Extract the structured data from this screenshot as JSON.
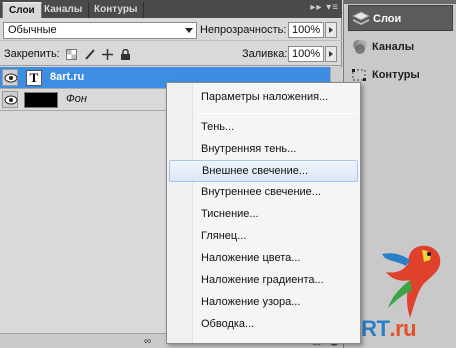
{
  "tabs": [
    {
      "label": "Слои"
    },
    {
      "label": "Каналы"
    },
    {
      "label": "Контуры"
    }
  ],
  "panel_menu_icon": "double-chevron-menu-icon",
  "blend": {
    "mode": "Обычные",
    "opacity_label": "Непрозрачность:",
    "opacity_value": "100%"
  },
  "lock": {
    "label": "Закрепить:",
    "fill_label": "Заливка:",
    "fill_value": "100%",
    "icons": [
      "lock-transparency-icon",
      "lock-brush-icon",
      "lock-move-icon",
      "lock-all-icon"
    ]
  },
  "layers": [
    {
      "name": "8art.ru",
      "type": "text",
      "selected": true
    },
    {
      "name": "Фон",
      "type": "raster",
      "selected": false
    }
  ],
  "dock": {
    "items": [
      {
        "label": "Слои"
      },
      {
        "label": "Каналы"
      },
      {
        "label": "Контуры"
      }
    ]
  },
  "context_menu": {
    "items": [
      {
        "label": "Параметры наложения..."
      },
      {
        "label": "Тень..."
      },
      {
        "label": "Внутренняя тень..."
      },
      {
        "label": "Внешнее свечение..."
      },
      {
        "label": "Внутреннее свечение..."
      },
      {
        "label": "Тиснение..."
      },
      {
        "label": "Глянец..."
      },
      {
        "label": "Наложение цвета..."
      },
      {
        "label": "Наложение градиента..."
      },
      {
        "label": "Наложение узора..."
      },
      {
        "label": "Обводка..."
      }
    ],
    "hovered": "Внешнее свечение..."
  },
  "watermark": {
    "text_a": "8ART",
    "text_b": ".ru"
  },
  "colors": {
    "selection": "#3d8ee3",
    "watermark_blue": "#2a80c7",
    "watermark_red": "#e54f2e"
  }
}
